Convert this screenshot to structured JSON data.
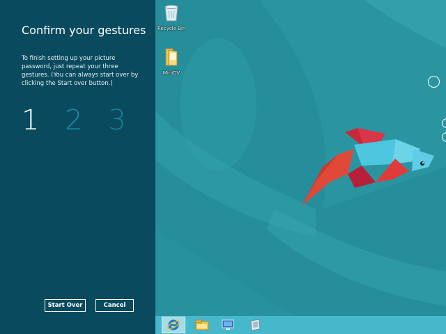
{
  "panel": {
    "title": "Confirm your gestures",
    "instructions": "To finish setting up your picture password, just repeat your three gestures. (You can always start over by clicking the Start over button.)",
    "steps": [
      "1",
      "2",
      "3"
    ],
    "start_over_label": "Start Over",
    "cancel_label": "Cancel"
  },
  "desktop": {
    "icons": [
      {
        "label": "Recycle Bin",
        "icon": "recycle-bin-icon"
      },
      {
        "label": "MiniDV",
        "icon": "folder-icon"
      }
    ]
  },
  "taskbar": {
    "items": [
      "internet-explorer-icon",
      "file-explorer-icon",
      "remote-desktop-icon",
      "notes-icon"
    ]
  },
  "colors": {
    "panel_bg": "#0a4a5e",
    "desktop_bg": "#258e9a",
    "taskbar_bg": "#46b8cc",
    "fish_red": "#c8283a",
    "fish_blue": "#4ec6e0"
  }
}
